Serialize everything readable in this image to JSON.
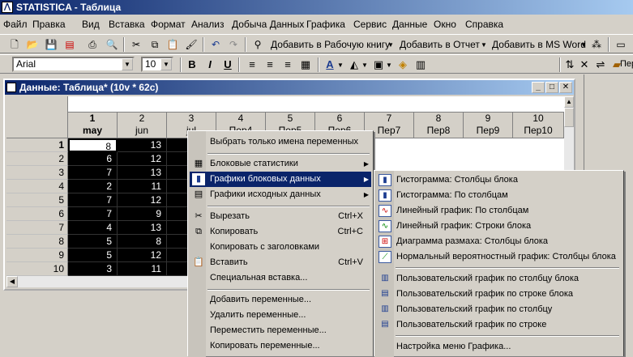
{
  "window": {
    "title": "STATISTICA - Таблица"
  },
  "menu": [
    {
      "label": "Файл"
    },
    {
      "label": "Правка"
    },
    {
      "label": "Вид"
    },
    {
      "label": "Вставка"
    },
    {
      "label": "Формат"
    },
    {
      "label": "Анализ"
    },
    {
      "label": "Добыча Данных"
    },
    {
      "label": "Графика"
    },
    {
      "label": "Сервис"
    },
    {
      "label": "Данные"
    },
    {
      "label": "Окно"
    },
    {
      "label": "Справка"
    }
  ],
  "toolbar": {
    "add_workbook": "Добавить в Рабочую книгу",
    "add_report": "Добавить в Отчет",
    "add_word": "Добавить в MS Word",
    "right_label": "Пере"
  },
  "format": {
    "font": "Arial",
    "size": "10",
    "bold": "B",
    "italic": "I",
    "underline": "U"
  },
  "data_window": {
    "title": "Данные: Таблица* (10v * 62c)"
  },
  "columns": [
    {
      "num": "1",
      "name": "may"
    },
    {
      "num": "2",
      "name": "jun"
    },
    {
      "num": "3",
      "name": "jul"
    },
    {
      "num": "4",
      "name": "Пер4"
    },
    {
      "num": "5",
      "name": "Пер5"
    },
    {
      "num": "6",
      "name": "Пер6"
    },
    {
      "num": "7",
      "name": "Пер7"
    },
    {
      "num": "8",
      "name": "Пер8"
    },
    {
      "num": "9",
      "name": "Пер9"
    },
    {
      "num": "10",
      "name": "Пер10"
    }
  ],
  "rows": [
    {
      "n": "1",
      "c1": "8",
      "c2": "13"
    },
    {
      "n": "2",
      "c1": "6",
      "c2": "12"
    },
    {
      "n": "3",
      "c1": "7",
      "c2": "13"
    },
    {
      "n": "4",
      "c1": "2",
      "c2": "11"
    },
    {
      "n": "5",
      "c1": "7",
      "c2": "12"
    },
    {
      "n": "6",
      "c1": "7",
      "c2": "9"
    },
    {
      "n": "7",
      "c1": "4",
      "c2": "13"
    },
    {
      "n": "8",
      "c1": "5",
      "c2": "8"
    },
    {
      "n": "9",
      "c1": "5",
      "c2": "12"
    },
    {
      "n": "10",
      "c1": "3",
      "c2": "11"
    }
  ],
  "context_menu": {
    "select_names": "Выбрать только имена переменных",
    "block_stats": "Блоковые статистики",
    "block_graphs": "Графики блоковых данных",
    "source_graphs": "Графики исходных данных",
    "cut": "Вырезать",
    "cut_sc": "Ctrl+X",
    "copy": "Копировать",
    "copy_sc": "Ctrl+C",
    "copy_headers": "Копировать с заголовками",
    "paste": "Вставить",
    "paste_sc": "Ctrl+V",
    "paste_special": "Специальная вставка...",
    "add_vars": "Добавить переменные...",
    "del_vars": "Удалить переменные...",
    "move_vars": "Переместить переменные...",
    "copy_vars": "Копировать переменные..."
  },
  "submenu": {
    "hist_block": "Гистограмма: Столбцы блока",
    "hist_cols": "Гистограмма: По столбцам",
    "line_cols": "Линейный график: По столбцам",
    "line_rows": "Линейный график: Строки блока",
    "range_plot": "Диаграмма размаха: Столбцы блока",
    "normal_plot": "Нормальный вероятностный график: Столбцы блока",
    "user_col_block": "Пользовательский график по столбцу блока",
    "user_row_block": "Пользовательский график по строке блока",
    "user_col": "Пользовательский график по столбцу",
    "user_row": "Пользовательский график по строке",
    "settings": "Настройка меню Графика..."
  }
}
